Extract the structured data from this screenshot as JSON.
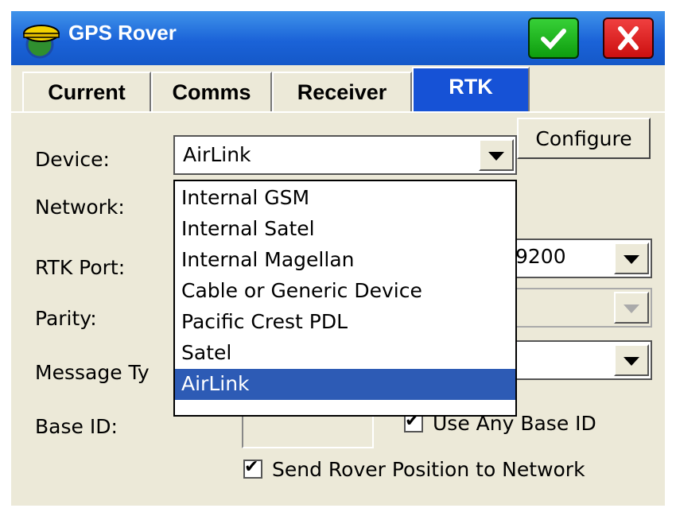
{
  "window": {
    "title": "GPS Rover",
    "ok_icon": "checkmark-icon",
    "close_icon": "close-icon",
    "colors": {
      "titlebar": "#1b63d8",
      "ok": "#0e9d0e",
      "close": "#cc1010",
      "selection": "#2d5bb5"
    }
  },
  "tabs": [
    {
      "label": "Current"
    },
    {
      "label": "Comms"
    },
    {
      "label": "Receiver"
    },
    {
      "label": "RTK",
      "active": true
    }
  ],
  "form": {
    "device_label": "Device:",
    "device_value": "AirLink",
    "configure_label": "Configure",
    "network_label": "Network:",
    "rtk_port_label": "RTK Port:",
    "rtk_port_value": "9200",
    "parity_label": "Parity:",
    "message_type_label": "Message Ty",
    "base_id_label": "Base ID:",
    "base_id_value": "",
    "use_any_base_label": "Use Any Base ID",
    "use_any_base_checked": true,
    "send_rover_label": "Send Rover Position to Network",
    "send_rover_checked": true
  },
  "device_options": [
    "Internal GSM",
    "Internal Satel",
    "Internal Magellan",
    "Cable or Generic Device",
    "Pacific Crest PDL",
    "Satel",
    "AirLink"
  ],
  "device_selected_index": 6
}
